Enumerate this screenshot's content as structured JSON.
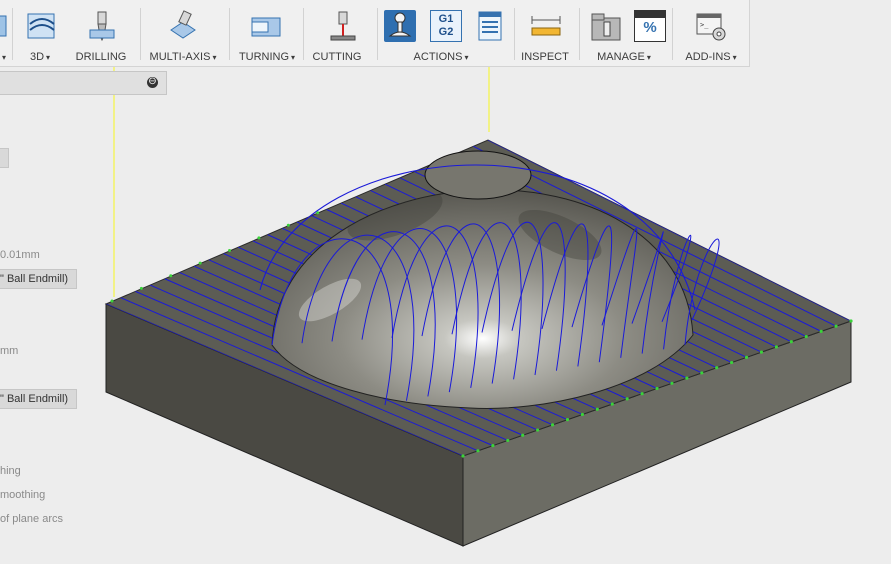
{
  "toolbar": {
    "groups": [
      {
        "label": "",
        "caret": "▾"
      },
      {
        "label": "3D",
        "caret": "▾"
      },
      {
        "label": "DRILLING",
        "caret": ""
      },
      {
        "label": "MULTI-AXIS",
        "caret": "▾"
      },
      {
        "label": "TURNING",
        "caret": "▾"
      },
      {
        "label": "CUTTING",
        "caret": ""
      },
      {
        "label": "ACTIONS",
        "caret": "▾"
      },
      {
        "label": "INSPECT",
        "caret": ""
      },
      {
        "label": "MANAGE",
        "caret": "▾"
      },
      {
        "label": "ADD-INS",
        "caret": "▾"
      }
    ],
    "actions_icon_text": {
      "line1": "G1",
      "line2": "G2"
    },
    "manage_icon_text": "%"
  },
  "panel": {
    "collapse_icon": "⊖",
    "tolerance": "0.01mm",
    "tool1": "\" Ball Endmill)",
    "stepover": "mm",
    "tool2": "\" Ball Endmill)",
    "opt1": "hing",
    "opt2": "moothing",
    "opt3": "of plane arcs"
  },
  "colors": {
    "accent": "#2f6fb0",
    "toolpath": "#1a1ad8",
    "rapid": "#ffff33",
    "stock_top": "#5b5b52",
    "stock_side_left": "#45443e",
    "stock_side_front": "#6a6a62"
  }
}
